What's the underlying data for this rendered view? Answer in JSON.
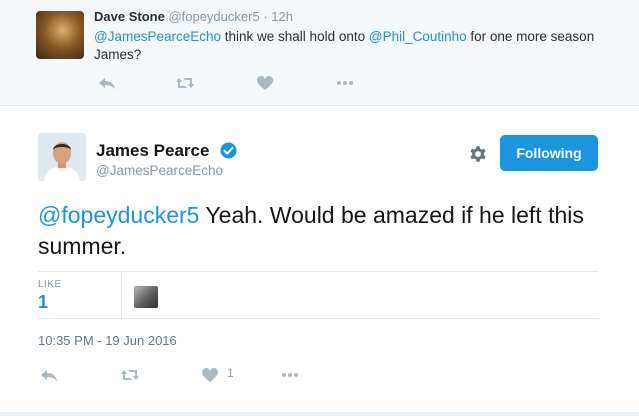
{
  "reply": {
    "name": "Dave Stone",
    "handle": "@fopeyducker5",
    "time": "· 12h",
    "mention1": "@JamesPearceEcho",
    "text1": " think we shall hold onto ",
    "mention2": "@Phil_Coutinho",
    "text2": " for one more season James?"
  },
  "tweet": {
    "name": "James Pearce",
    "handle": "@JamesPearceEcho",
    "follow_label": "Following",
    "mention": "@fopeyducker5",
    "text": " Yeah. Would be amazed if he left this summer.",
    "like_label": "LIKE",
    "like_count": "1",
    "timestamp": "10:35 PM - 19 Jun 2016",
    "action_like_count": "1"
  },
  "icons": [
    "reply-icon",
    "retweet-icon",
    "heart-icon",
    "more-icon",
    "verified-icon",
    "gear-icon"
  ],
  "colors": {
    "accent": "#1b95e0",
    "muted": "#8899a6",
    "icon": "#aab8c2",
    "reply_background": "#f5f8fa"
  }
}
